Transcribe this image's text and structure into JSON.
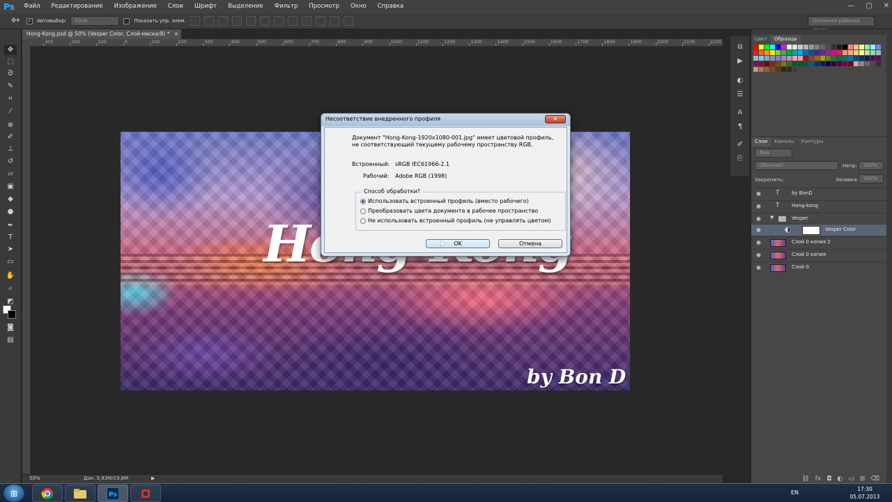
{
  "app": {
    "logo": "Ps",
    "menu": [
      "Файл",
      "Редактирование",
      "Изображение",
      "Слои",
      "Шрифт",
      "Выделение",
      "Фильтр",
      "Просмотр",
      "Окно",
      "Справка"
    ],
    "window_controls": {
      "minimize": "—",
      "maximize": "□",
      "close": "✕"
    }
  },
  "options": {
    "autoselect_label": "Автовыбор:",
    "autoselect_value": "Слой",
    "show_controls_label": "Показать упр. элем.",
    "workspace": "Основная рабочая среда"
  },
  "document": {
    "tab_title": "Hong-Kong.psd @ 50% (Vesper Color, Слой-маска/8) *",
    "tab_close": "×",
    "ruler_ticks": [
      "300",
      "200",
      "100",
      "0",
      "100",
      "200",
      "300",
      "400",
      "500",
      "600",
      "700",
      "800",
      "900",
      "1000",
      "1100",
      "1200",
      "1300",
      "1400",
      "1500",
      "1600",
      "1700",
      "1800",
      "1900",
      "2000",
      "2100",
      "2200"
    ],
    "image_title": "Hong-Kong",
    "image_credit": "by Bon D"
  },
  "dialog": {
    "title": "Несоответствие внедренного профиля",
    "close": "✕",
    "message_line1": "Документ \"Hong-Kong-1920x1080-001.jpg\" имеет цветовой профиль,",
    "message_line2": "не соответствующий текущему рабочему пространству RGB.",
    "embedded_label": "Встроенный:",
    "embedded_value": "sRGB IEC61966-2.1",
    "working_label": "Рабочий:",
    "working_value": "Adobe RGB (1998)",
    "group_label": "Способ обработки?",
    "options": [
      "Использовать встроенный профиль (вместо рабочего)",
      "Преобразовать цвета документа в рабочее пространство",
      "Не использовать встроенный профиль (не управлять цветом)"
    ],
    "selected_option": 0,
    "ok_label": "OK",
    "cancel_label": "Отмена"
  },
  "swatches": {
    "tabs": [
      "Цвет",
      "Образцы"
    ],
    "active_tab": 1,
    "colors": [
      "#ff0000",
      "#ffff00",
      "#00ff00",
      "#00ffff",
      "#0000ff",
      "#ff00ff",
      "#ffffff",
      "#e6e6e6",
      "#cccccc",
      "#b3b3b3",
      "#999999",
      "#808080",
      "#666666",
      "#4d4d4d",
      "#333333",
      "#1a1a1a",
      "#000000",
      "#ff8080",
      "#ffc080",
      "#ffff80",
      "#80ff80",
      "#80ffff",
      "#8080ff",
      "#ed1c24",
      "#f26522",
      "#f7941d",
      "#fff200",
      "#8dc63f",
      "#39b54a",
      "#00a651",
      "#00a99d",
      "#00aeef",
      "#0072bc",
      "#0054a6",
      "#2e3192",
      "#662d91",
      "#92278f",
      "#ec008c",
      "#ed145b",
      "#f69679",
      "#f9ad81",
      "#fdc68a",
      "#fff799",
      "#c4df9b",
      "#a3d39c",
      "#82ca9c",
      "#7accc8",
      "#6dcff6",
      "#7da7d9",
      "#8393ca",
      "#8781bd",
      "#a186be",
      "#bd8cbf",
      "#f49ac1",
      "#f5989d",
      "#9e0b0f",
      "#a0410d",
      "#a36209",
      "#aba000",
      "#598527",
      "#1a7b30",
      "#007236",
      "#00746b",
      "#0076a3",
      "#004b80",
      "#003471",
      "#1b1464",
      "#440e62",
      "#630460",
      "#9e005d",
      "#9e0039",
      "#790000",
      "#7b2e00",
      "#7d4900",
      "#827b00",
      "#406618",
      "#005e20",
      "#005826",
      "#005952",
      "#005b7f",
      "#003663",
      "#002157",
      "#0d004c",
      "#32004b",
      "#4b0049",
      "#7b0046",
      "#7a0026",
      "#c7b299",
      "#998675",
      "#736357",
      "#534741",
      "#362f2d",
      "#c69c6d",
      "#a67c52",
      "#8c6239",
      "#754c24",
      "#603913",
      "#42210b",
      "#2b2b2b",
      "#3d3d3d"
    ]
  },
  "layers": {
    "tabs": [
      "Слои",
      "Каналы",
      "Контуры"
    ],
    "active_tab": 0,
    "filter_label": "Вид",
    "blend_mode": "Обычные",
    "opacity_label": "Непр:",
    "opacity_value": "100%",
    "lock_label": "Закрепить:",
    "fill_label": "Заливка:",
    "fill_value": "100%",
    "items": [
      {
        "name": "by BonD",
        "kind": "text"
      },
      {
        "name": "Hong-kong",
        "kind": "text"
      },
      {
        "name": "Vesper",
        "kind": "group"
      },
      {
        "name": "Vesper Color",
        "kind": "adjustment",
        "selected": true
      },
      {
        "name": "Слой 0 копия 2",
        "kind": "pixel"
      },
      {
        "name": "Слой 0 копия",
        "kind": "pixel"
      },
      {
        "name": "Слой 0",
        "kind": "pixel"
      }
    ],
    "bottom_icons": [
      "link-icon",
      "fx-icon",
      "mask-icon",
      "adjustment-icon",
      "folder-icon",
      "new-layer-icon",
      "trash-icon"
    ]
  },
  "status": {
    "zoom": "50%",
    "doc_size": "Док: 5,93М/19,8М",
    "arrow": "▶"
  },
  "taskbar": {
    "language": "EN",
    "time": "17:30",
    "date": "05.07.2013",
    "apps": [
      "chrome-icon",
      "explorer-icon",
      "photoshop-icon",
      "app-icon"
    ],
    "active_app": 2
  }
}
